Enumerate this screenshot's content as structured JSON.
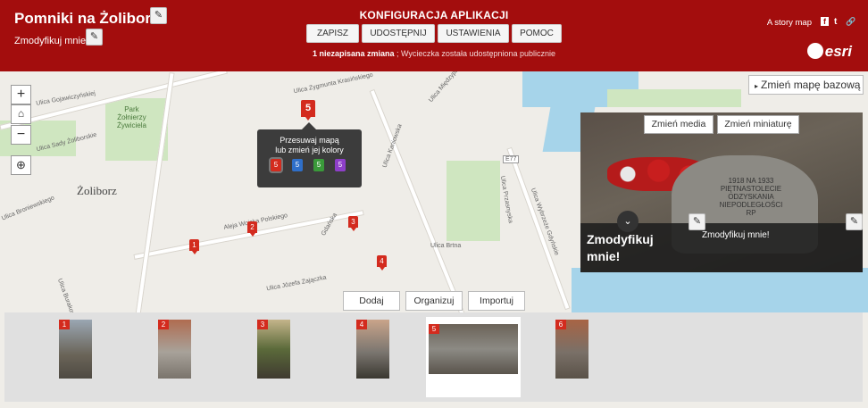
{
  "header": {
    "title": "Pomniki na Żoliborzu",
    "subtitle": "Zmodyfikuj mnie!",
    "config_title": "KONFIGURACJA APLIKACJI",
    "buttons": [
      "ZAPISZ",
      "UDOSTĘPNIJ",
      "USTAWIENIA",
      "POMOC"
    ],
    "status_bold": "1 niezapisana zmiana",
    "status_rest": " ; Wycieczka została udostępniona publicznie",
    "storymap_label": "A story map",
    "social": {
      "facebook": "f",
      "twitter": "t",
      "link": "🔗"
    },
    "logo_text": "esri"
  },
  "map": {
    "district": "Żoliborz",
    "park": [
      "Park",
      "Żołnierzy",
      "Żywiciela"
    ],
    "streets": [
      "Ulica Gojawiczyńskiej",
      "Ulica Zygmunta Krasińskiego",
      "Ulica Sady Żoliborskie",
      "Ulica Kaniowska",
      "Aleja Wojska Polskiego",
      "Ulica Broniewskiego",
      "Ulica Wybrzeże Gdyńskie",
      "Ulica Burakowska",
      "Ulica Józefa Zajączka",
      "Ulica Przasnyska",
      "Gdańska",
      "Ulica Brtna",
      "Ulica Międzyparkowa"
    ],
    "road_badge": "E77",
    "zoom_in": "+",
    "zoom_out": "−",
    "home_icon": "home-icon",
    "locate_icon": "locate-icon",
    "markers": [
      "1",
      "2",
      "3",
      "4",
      "5"
    ],
    "tooltip": {
      "line1": "Przesuwaj mapą",
      "line2": "lub zmień jej kolory",
      "swatches": [
        {
          "num": "5",
          "color": "#d32b1e"
        },
        {
          "num": "5",
          "color": "#2f6fc9"
        },
        {
          "num": "5",
          "color": "#3a9a3a"
        },
        {
          "num": "5",
          "color": "#8e3fc9"
        }
      ]
    },
    "basemap_button": "Zmień mapę bazową"
  },
  "media": {
    "change_media": "Zmień media",
    "change_thumbnail": "Zmień miniaturę",
    "stone_text": [
      "1918",
      "NA",
      "1933",
      "PIĘTNASTOLECIE",
      "ODZYSKANIA",
      "NIEPODLEGŁOŚCI",
      "RP"
    ],
    "caption_title": "Zmodyfikuj mnie!",
    "caption_sub": "Zmodyfikuj mnie!"
  },
  "carousel": {
    "controls": [
      "Dodaj",
      "Organizuj",
      "Importuj"
    ],
    "thumbs": [
      "1",
      "2",
      "3",
      "4",
      "5",
      "6"
    ]
  },
  "colors": {
    "header": "#a30d0d",
    "marker": "#d32b1e",
    "water": "#a6d4ea",
    "park": "#cfe6c0"
  }
}
